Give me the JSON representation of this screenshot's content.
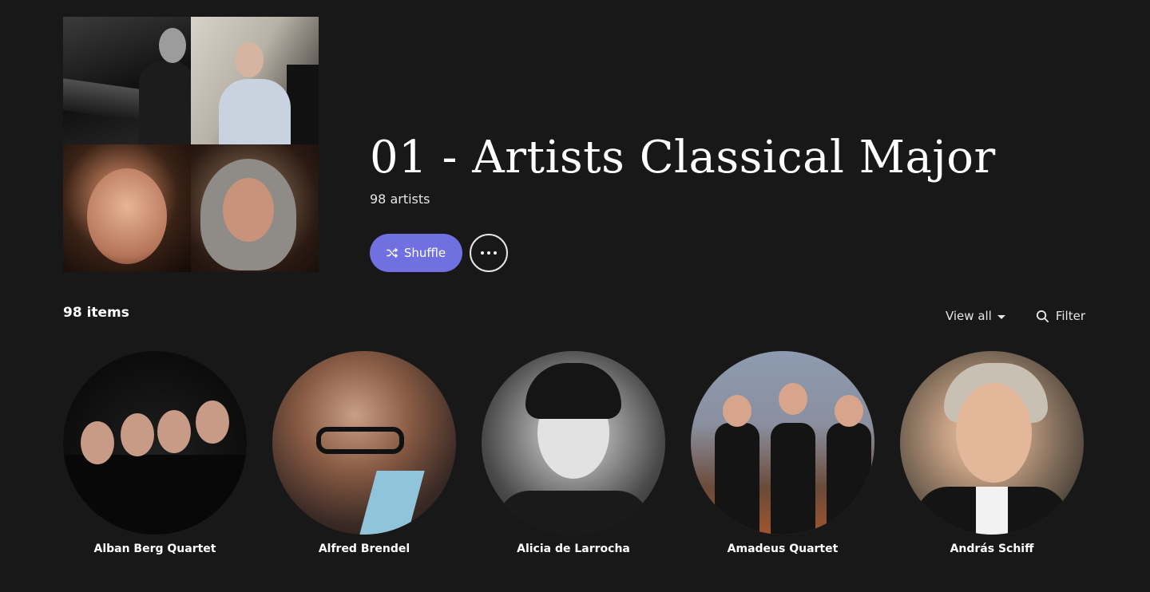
{
  "playlist": {
    "title": "01 - Artists Classical Major",
    "subtitle": "98 artists",
    "cover_icon": "collage-image"
  },
  "actions": {
    "shuffle_label": "Shuffle",
    "shuffle_icon": "shuffle-icon",
    "more_icon": "more-options-icon"
  },
  "list": {
    "count_label": "98 items",
    "view_label": "View all",
    "filter_label": "Filter",
    "filter_icon": "search-icon"
  },
  "artists": [
    {
      "name": "Alban Berg Quartet"
    },
    {
      "name": "Alfred Brendel"
    },
    {
      "name": "Alicia de Larrocha"
    },
    {
      "name": "Amadeus Quartet"
    },
    {
      "name": "András Schiff"
    }
  ],
  "colors": {
    "background": "#181818",
    "accent": "#7070e0",
    "text": "#ffffff"
  }
}
